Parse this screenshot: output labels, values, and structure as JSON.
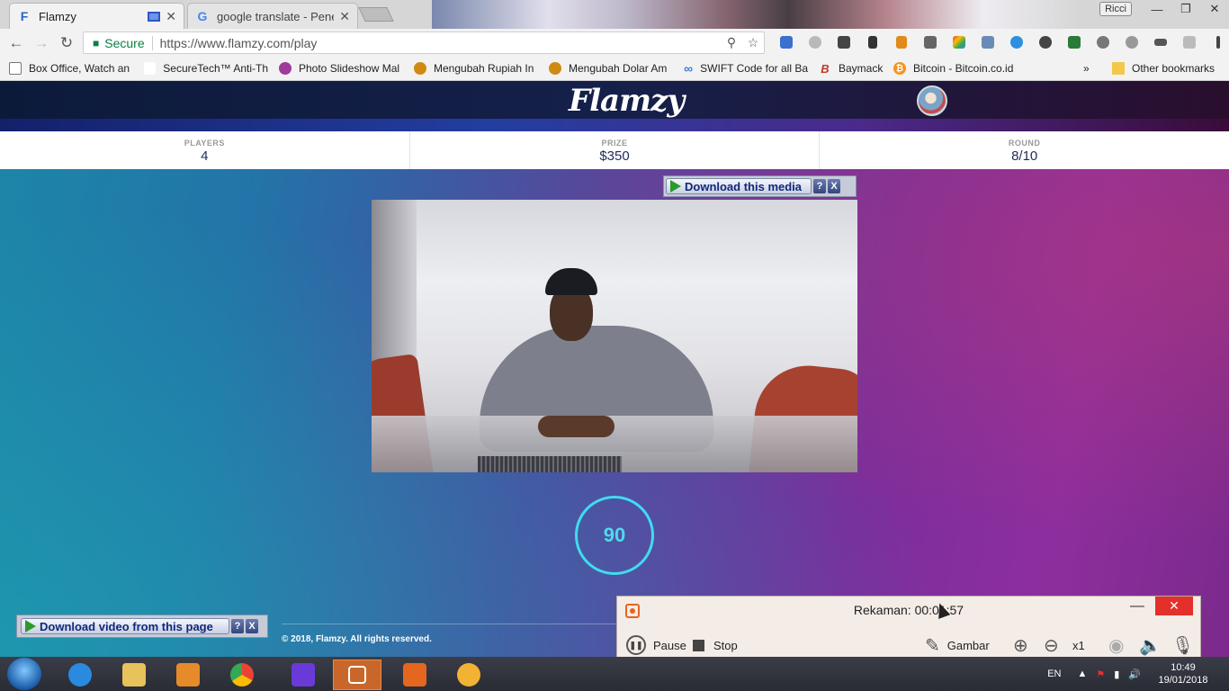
{
  "browser": {
    "tabs": [
      {
        "title": "Flamzy",
        "favicon": "F",
        "active": true
      },
      {
        "title": "google translate - Penelu",
        "favicon": "G",
        "active": false
      }
    ],
    "profile": "Ricci",
    "omnibox": {
      "secure_label": "Secure",
      "url": "https://www.flamzy.com/play"
    },
    "bookmarks": [
      {
        "label": "Box Office, Watch an",
        "color": "#444"
      },
      {
        "label": "SecureTech™ Anti-Th",
        "color": "#ffffff"
      },
      {
        "label": "Photo Slideshow Mal",
        "color": "#a03a9a"
      },
      {
        "label": "Mengubah Rupiah In",
        "color": "#d08a12"
      },
      {
        "label": "Mengubah Dolar Am",
        "color": "#d08a12"
      },
      {
        "label": "SWIFT Code for all Ba",
        "color": "#3a7ad8"
      },
      {
        "label": "Baymack",
        "color": "#c0392b"
      },
      {
        "label": "Bitcoin - Bitcoin.co.id",
        "color": "#f7931a"
      }
    ],
    "bookmarks_more": "»",
    "other_bookmarks": "Other bookmarks"
  },
  "site": {
    "logo": "Flamzy",
    "stats": [
      {
        "label": "PLAYERS",
        "value": "4"
      },
      {
        "label": "PRIZE",
        "value": "$350"
      },
      {
        "label": "ROUND",
        "value": "8/10"
      }
    ],
    "countdown": "90",
    "footer": "© 2018, Flamzy. All rights reserved."
  },
  "overlays": {
    "download_media": "Download this media",
    "download_page": "Download video from this page",
    "help": "?",
    "close": "X"
  },
  "recorder": {
    "title": "Rekaman:  00:01:57",
    "pause": "Pause",
    "stop": "Stop",
    "draw": "Gambar",
    "zoom_level": "x1"
  },
  "taskbar": {
    "language": "EN",
    "time": "10:49",
    "date": "19/01/2018"
  },
  "colors": {
    "accent_timer": "#3fdcef",
    "record_close": "#e3302a",
    "secure_green": "#0b8043"
  }
}
